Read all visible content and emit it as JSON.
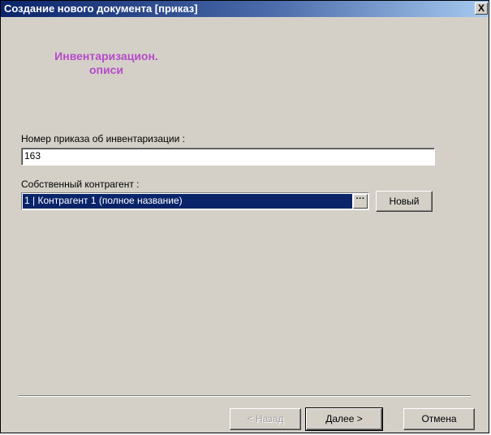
{
  "window": {
    "title": "Создание нового документа [приказ]",
    "close_glyph": "X"
  },
  "header": {
    "line1": "Инвентаризацион.",
    "line2": "описи"
  },
  "order_number": {
    "label": "Номер приказа об инвентаризации :",
    "value": "163"
  },
  "counterparty": {
    "label": "Собственный контрагент :",
    "value": "1 | Контрагент 1 (полное название)",
    "browse_glyph": "···",
    "new_button": "Новый"
  },
  "footer": {
    "back_button": "< Назад",
    "next_button": "Далее >",
    "cancel_button": "Отмена"
  },
  "colors": {
    "header_text": "#b64bc8",
    "selection": "#0a246a",
    "dialog_bg": "#d4d0c8"
  }
}
